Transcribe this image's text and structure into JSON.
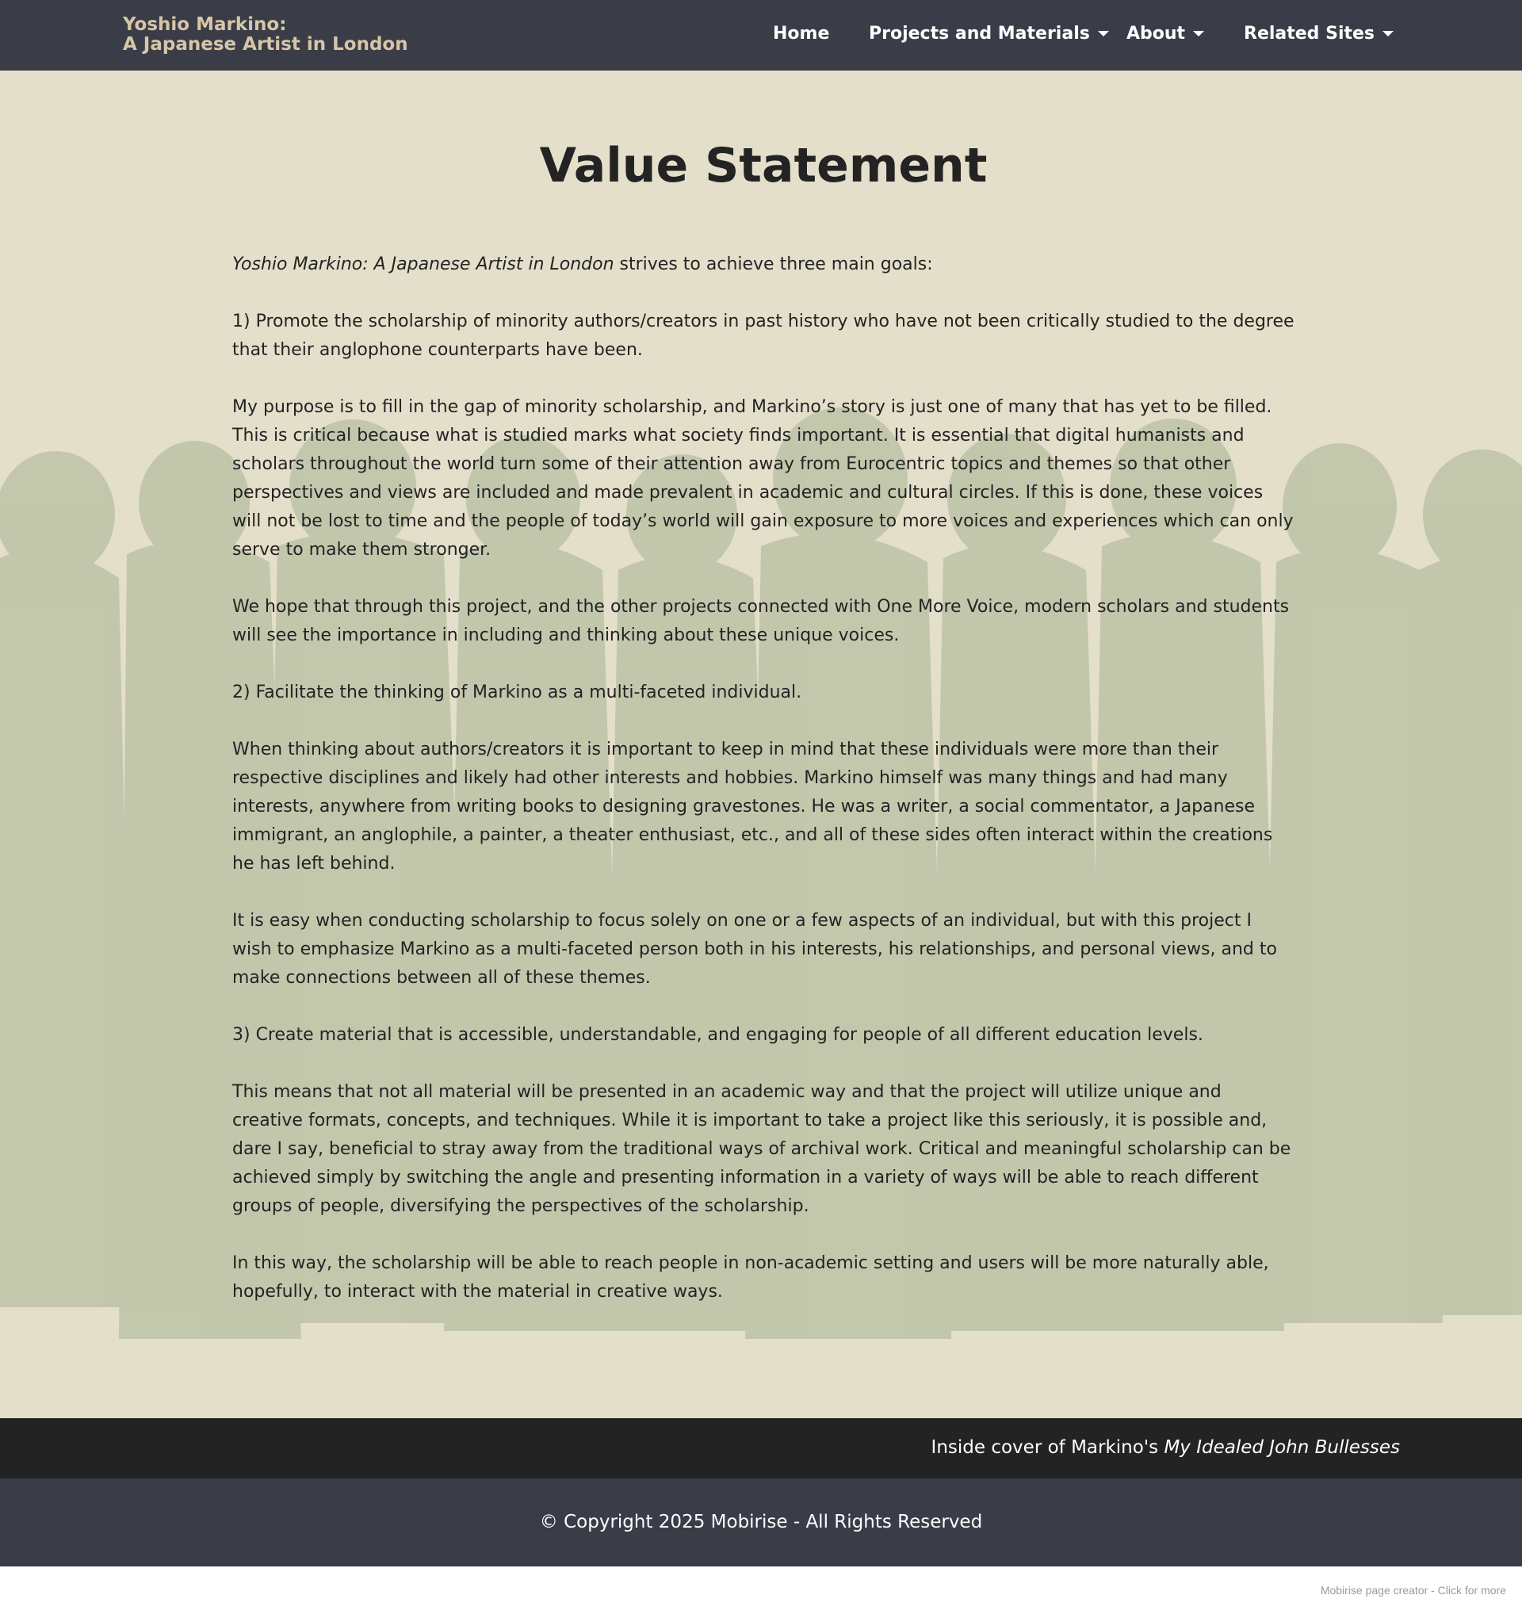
{
  "navbar": {
    "brand_line1": "Yoshio Markino:",
    "brand_line2": "A Japanese Artist in London",
    "items": [
      {
        "label": "Home",
        "has_dropdown": false
      },
      {
        "label": "Projects and Materials",
        "has_dropdown": true
      },
      {
        "label": "About",
        "has_dropdown": true
      },
      {
        "label": "Related Sites",
        "has_dropdown": true
      }
    ]
  },
  "main": {
    "title": "Value Statement",
    "intro_italic": "Yoshio Markino: A Japanese Artist in London",
    "intro_rest": " strives to achieve three main goals:",
    "paragraphs": [
      "1) Promote the scholarship of minority authors/creators in past history who have not been critically studied to the degree that their anglophone counterparts have been.",
      "My purpose is to fill in the gap of minority scholarship, and Markino’s story is just one of many that has yet to be filled. This is critical because what is studied marks what society finds important. It is essential that digital humanists and scholars throughout the world turn some of their attention away from Eurocentric topics and themes so that other perspectives and views are included and made prevalent in academic and cultural circles. If this is done, these voices will not be lost to time and the people of today’s world will gain exposure to more voices and experiences which can only serve to make them stronger.",
      "We hope that through this project, and the other projects connected with One More Voice, modern scholars and students will see the importance in including and thinking about these unique voices.",
      "2) Facilitate the thinking of Markino as a multi-faceted individual.",
      "When thinking about authors/creators it is important to keep in mind that these individuals were more than their respective disciplines and likely had other interests and hobbies. Markino himself was many things and had many interests, anywhere from writing books to designing gravestones. He was a writer, a social commentator, a Japanese immigrant, an anglophile, a painter, a theater enthusiast, etc., and all of these sides often interact within the creations he has left behind.",
      "It is easy when conducting scholarship to focus solely on one or a few aspects of an individual, but with this project I wish to emphasize Markino as a multi-faceted person both in his interests, his relationships, and personal views, and to make connections between all of these themes.",
      "3) Create material that is accessible, understandable, and engaging for people of all different education levels.",
      "This means that not all material will be presented in an academic way and that the project will utilize unique and creative formats, concepts, and techniques. While it is important to take a project like this seriously, it is possible and, dare I say, beneficial to stray away from the traditional ways of archival work. Critical and meaningful scholarship can be achieved simply by switching the angle and presenting information in a variety of ways will be able to reach different groups of people, diversifying the perspectives of the scholarship.",
      "In this way, the scholarship will be able to reach people in non-academic setting and users will be more naturally able, hopefully, to interact with the material in creative ways."
    ]
  },
  "caption": {
    "prefix": "Inside cover of Markino's ",
    "italic": "My Idealed John Bullesses"
  },
  "footer": {
    "copyright": "© Copyright 2025 Mobirise - All Rights Reserved"
  },
  "credit": {
    "text": "Mobirise page creator - Click for more"
  },
  "colors": {
    "navbar_bg": "#3a3d47",
    "brand_text": "#d6c6a8",
    "page_bg": "#e4dfca",
    "silhouette": "#a8b594",
    "caption_bg": "#232323",
    "text": "#232323"
  }
}
